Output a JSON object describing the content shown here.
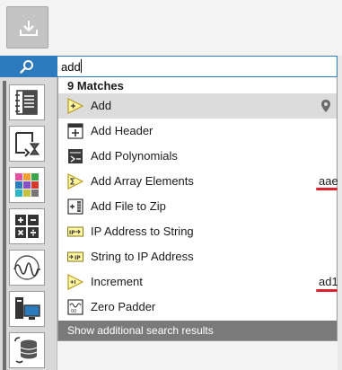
{
  "search": {
    "value": "add",
    "icon": "search-icon"
  },
  "toolbar": {
    "icon": "download-icon"
  },
  "palette": {
    "items": [
      {
        "icon": "notebook-icon"
      },
      {
        "icon": "loop-timer-icon"
      },
      {
        "icon": "color-grid-icon"
      },
      {
        "icon": "calculator-icon"
      },
      {
        "icon": "waveform-icon"
      },
      {
        "icon": "computer-io-icon"
      },
      {
        "icon": "database-sync-icon"
      }
    ]
  },
  "results": {
    "header": "9 Matches",
    "items": [
      {
        "label": "Add",
        "icon": "add-triangle-icon",
        "alias": "",
        "selected": true
      },
      {
        "label": "Add Header",
        "icon": "add-header-icon",
        "alias": ""
      },
      {
        "label": "Add Polynomials",
        "icon": "polynomial-icon",
        "alias": ""
      },
      {
        "label": "Add Array Elements",
        "icon": "sum-triangle-icon",
        "alias": "aae"
      },
      {
        "label": "Add File to Zip",
        "icon": "zip-file-icon",
        "alias": ""
      },
      {
        "label": "IP Address to String",
        "icon": "ip-to-string-icon",
        "alias": ""
      },
      {
        "label": "String to IP Address",
        "icon": "string-to-ip-icon",
        "alias": ""
      },
      {
        "label": "Increment",
        "icon": "increment-triangle-icon",
        "alias": "ad1"
      },
      {
        "label": "Zero Padder",
        "icon": "zero-padder-icon",
        "alias": ""
      }
    ],
    "footer": "Show additional search results"
  },
  "colors": {
    "accent": "#2c7bbd",
    "selected_row": "#dcdcdc",
    "footer_bg": "#7a7a7a",
    "annotation_red": "#e0202b"
  }
}
